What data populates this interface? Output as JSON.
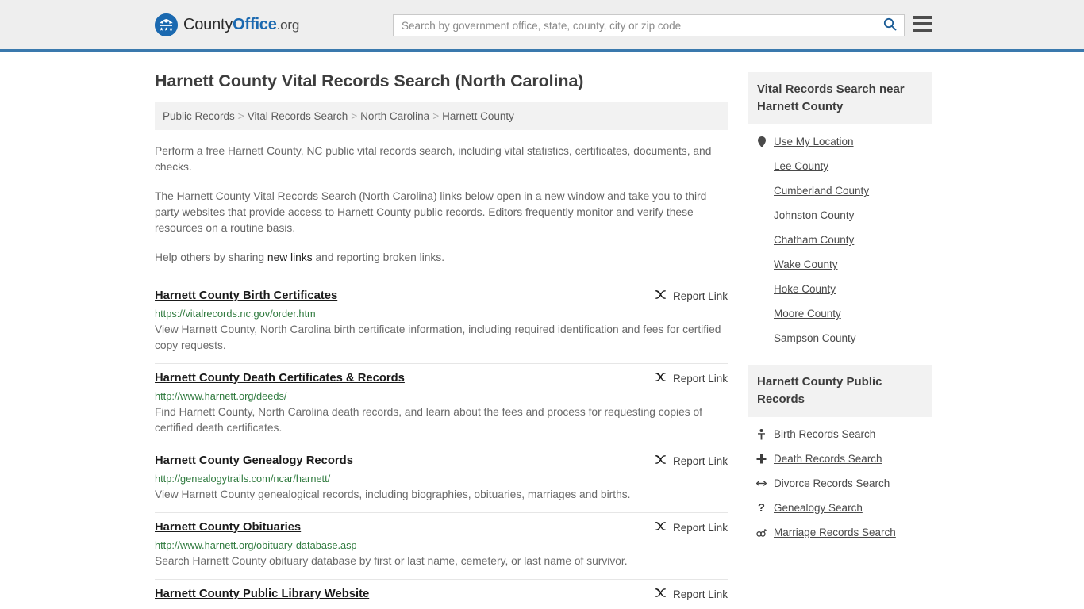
{
  "header": {
    "brand": {
      "part1": "County",
      "part2": "Office",
      "tld": ".org",
      "logo_icon": "eagle-shield-logo-icon"
    },
    "search": {
      "placeholder": "Search by government office, state, county, city or zip code",
      "value": "",
      "icon": "search-icon"
    },
    "menu": {
      "icon": "hamburger-menu-icon"
    }
  },
  "main": {
    "title": "Harnett County Vital Records Search (North Carolina)",
    "breadcrumb": [
      {
        "label": "Public Records"
      },
      {
        "label": "Vital Records Search"
      },
      {
        "label": "North Carolina"
      },
      {
        "label": "Harnett County"
      }
    ],
    "breadcrumb_separator": ">",
    "intro_1": "Perform a free Harnett County, NC public vital records search, including vital statistics, certificates, documents, and checks.",
    "intro_2": "The Harnett County Vital Records Search (North Carolina) links below open in a new window and take you to third party websites that provide access to Harnett County public records. Editors frequently monitor and verify these resources on a routine basis.",
    "intro_3_before": "Help others by sharing ",
    "intro_3_link": "new links",
    "intro_3_after": " and reporting broken links.",
    "report_link_label": "Report Link",
    "report_link_icon": "broken-link-icon",
    "results": [
      {
        "title": "Harnett County Birth Certificates",
        "url": "https://vitalrecords.nc.gov/order.htm",
        "description": "View Harnett County, North Carolina birth certificate information, including required identification and fees for certified copy requests."
      },
      {
        "title": "Harnett County Death Certificates & Records",
        "url": "http://www.harnett.org/deeds/",
        "description": "Find Harnett County, North Carolina death records, and learn about the fees and process for requesting copies of certified death certificates."
      },
      {
        "title": "Harnett County Genealogy Records",
        "url": "http://genealogytrails.com/ncar/harnett/",
        "description": "View Harnett County genealogical records, including biographies, obituaries, marriages and births."
      },
      {
        "title": "Harnett County Obituaries",
        "url": "http://www.harnett.org/obituary-database.asp",
        "description": "Search Harnett County obituary database by first or last name, cemetery, or last name of survivor."
      },
      {
        "title": "Harnett County Public Library Website",
        "url": "",
        "description": ""
      }
    ]
  },
  "rail": {
    "nearby": {
      "heading": "Vital Records Search near Harnett County",
      "items": [
        {
          "label": "Use My Location",
          "icon": "map-pin-icon"
        },
        {
          "label": "Lee County",
          "icon": ""
        },
        {
          "label": "Cumberland County",
          "icon": ""
        },
        {
          "label": "Johnston County",
          "icon": ""
        },
        {
          "label": "Chatham County",
          "icon": ""
        },
        {
          "label": "Wake County",
          "icon": ""
        },
        {
          "label": "Hoke County",
          "icon": ""
        },
        {
          "label": "Moore County",
          "icon": ""
        },
        {
          "label": "Sampson County",
          "icon": ""
        }
      ]
    },
    "public_records": {
      "heading": "Harnett County Public Records",
      "items": [
        {
          "label": "Birth Records Search",
          "icon": "baby-icon"
        },
        {
          "label": "Death Records Search",
          "icon": "cross-icon"
        },
        {
          "label": "Divorce Records Search",
          "icon": "split-arrows-icon"
        },
        {
          "label": "Genealogy Search",
          "icon": "question-mark-icon"
        },
        {
          "label": "Marriage Records Search",
          "icon": "gender-rings-icon"
        }
      ]
    }
  },
  "colors": {
    "brand_blue": "#1b69b0",
    "header_rule": "#3a79ad",
    "url_green": "#2f7a3e",
    "panel_gray": "#f2f2f2"
  }
}
